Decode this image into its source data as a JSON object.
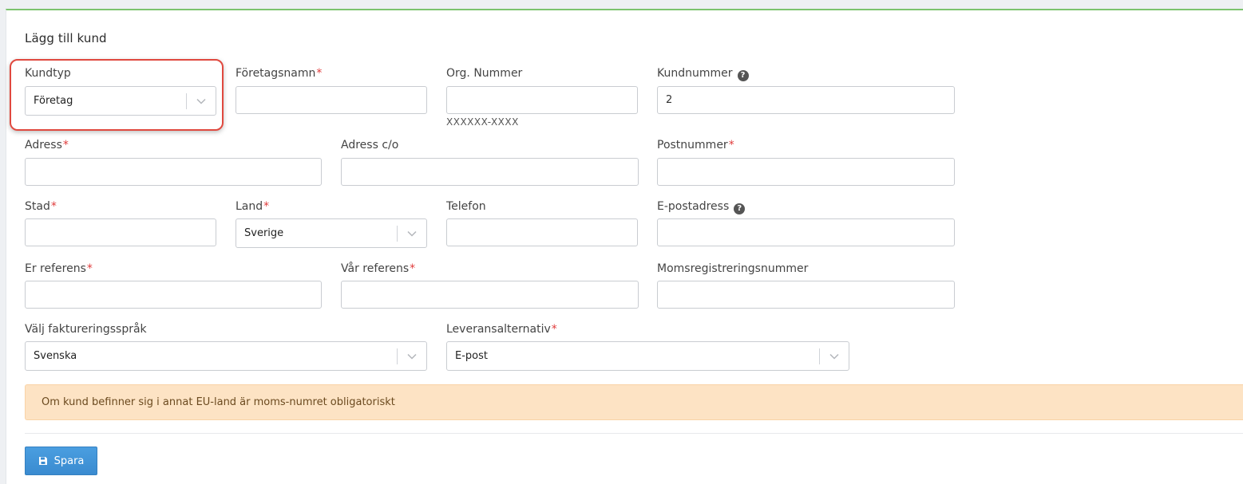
{
  "form": {
    "title": "Lägg till kund",
    "fields": {
      "kundtyp": {
        "label": "Kundtyp",
        "value": "Företag"
      },
      "foretagsnamn": {
        "label": "Företagsnamn",
        "value": ""
      },
      "org_nummer": {
        "label": "Org. Nummer",
        "value": "",
        "hint": "XXXXXX-XXXX"
      },
      "kundnummer": {
        "label": "Kundnummer",
        "value": "2"
      },
      "adress": {
        "label": "Adress",
        "value": ""
      },
      "adress_co": {
        "label": "Adress c/o",
        "value": ""
      },
      "postnummer": {
        "label": "Postnummer",
        "value": ""
      },
      "stad": {
        "label": "Stad",
        "value": ""
      },
      "land": {
        "label": "Land",
        "value": "Sverige"
      },
      "telefon": {
        "label": "Telefon",
        "value": ""
      },
      "epost": {
        "label": "E-postadress",
        "value": ""
      },
      "er_referens": {
        "label": "Er referens",
        "value": ""
      },
      "var_referens": {
        "label": "Vår referens",
        "value": ""
      },
      "moms": {
        "label": "Momsregistreringsnummer",
        "value": ""
      },
      "fakturasprak": {
        "label": "Välj faktureringsspråk",
        "value": "Svenska"
      },
      "leverans": {
        "label": "Leveransalternativ",
        "value": "E-post"
      }
    },
    "required_marker": "*",
    "help_glyph": "?",
    "alert": "Om kund befinner sig i annat EU-land är moms-numret obligatoriskt",
    "save_label": "Spara"
  },
  "colors": {
    "accent_top_border": "#7cc36e",
    "required": "#e03b3b",
    "highlight": "#e0493f",
    "alert_bg": "#fde3c4",
    "button": "#3a8bd0"
  },
  "icons": {
    "caret": "chevron-down-icon",
    "help": "question-circle-icon",
    "save": "floppy-disk-icon"
  }
}
